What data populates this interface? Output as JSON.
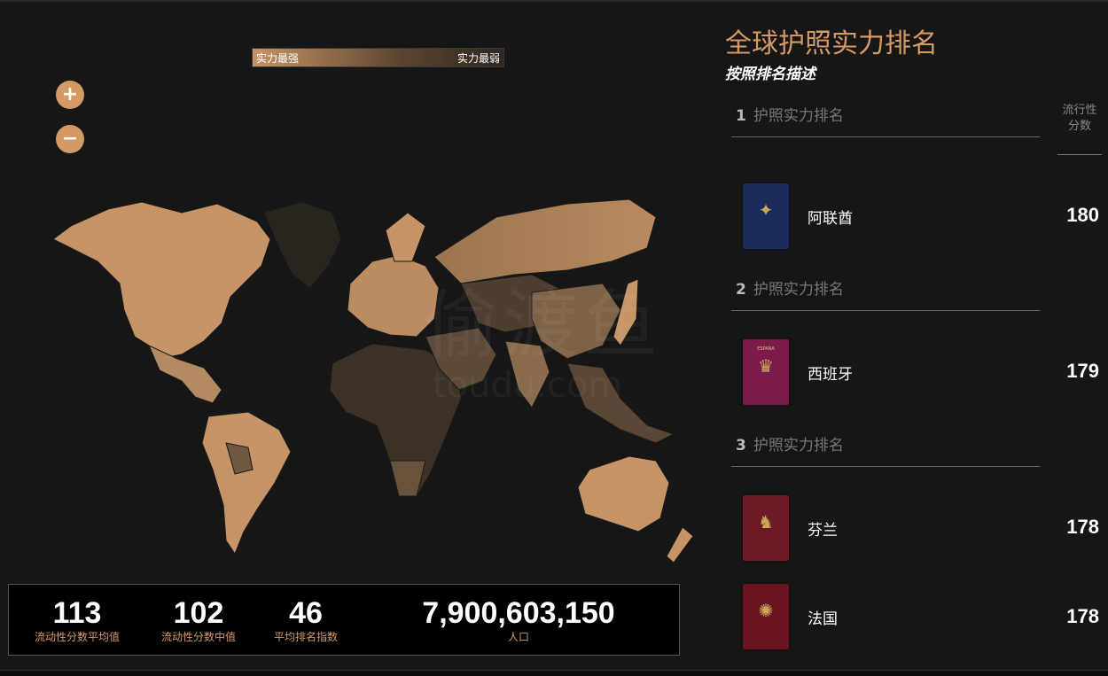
{
  "legend": {
    "left_label": "实力最强",
    "right_label": "实力最弱"
  },
  "zoom": {
    "in_label": "+",
    "out_label": "−"
  },
  "watermark": {
    "main": "偷渡鱼",
    "sub": "toudu.com"
  },
  "stats": [
    {
      "value": "113",
      "label": "流动性分数平均值"
    },
    {
      "value": "102",
      "label": "流动性分数中值"
    },
    {
      "value": "46",
      "label": "平均排名指数"
    },
    {
      "value": "7,900,603,150",
      "label": "人口"
    }
  ],
  "panel": {
    "title": "全球护照实力排名",
    "subtitle": "按照排名描述",
    "column_header": "流行性分数",
    "accent_color": "#d49a66"
  },
  "rankings": [
    {
      "rank": "1",
      "heading": "护照实力排名",
      "entries": [
        {
          "country": "阿联酋",
          "score": "180",
          "passport_color": "#1b2b5e",
          "passport_icon": "eagle-emblem-icon"
        }
      ]
    },
    {
      "rank": "2",
      "heading": "护照实力排名",
      "entries": [
        {
          "country": "西班牙",
          "score": "179",
          "passport_color": "#7d1a4a",
          "passport_icon": "crest-emblem-icon",
          "passport_text": "ESPAÑA"
        }
      ]
    },
    {
      "rank": "3",
      "heading": "护照实力排名",
      "entries": [
        {
          "country": "芬兰",
          "score": "178",
          "passport_color": "#6e1a24",
          "passport_icon": "lion-emblem-icon"
        },
        {
          "country": "法国",
          "score": "178",
          "passport_color": "#6a1420",
          "passport_icon": "seal-emblem-icon"
        }
      ]
    }
  ]
}
